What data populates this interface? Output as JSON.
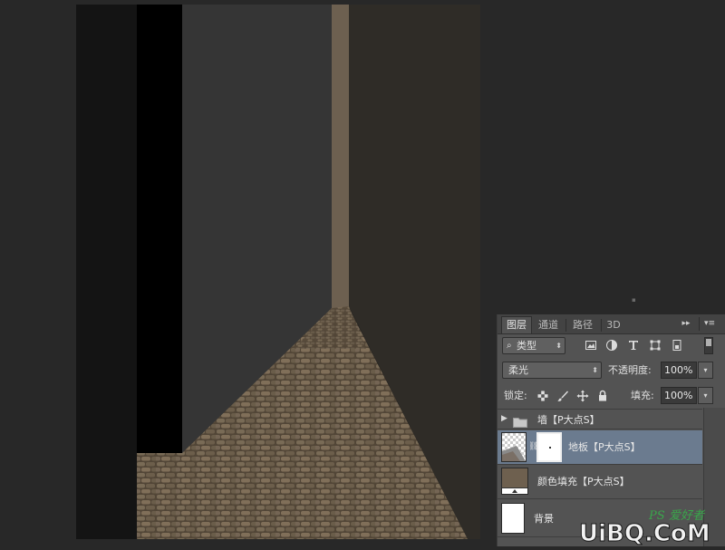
{
  "layers_panel": {
    "tabs": [
      {
        "label": "图层"
      },
      {
        "label": "通道"
      },
      {
        "label": "路径"
      },
      {
        "label": "3D"
      }
    ],
    "menu_expand_glyph": "▸▸",
    "menu_glyph": "▾≡",
    "filter": {
      "kind_label": "类型",
      "filter_icons": [
        "image-filter-icon",
        "adjustment-filter-icon",
        "type-filter-icon",
        "shape-filter-icon",
        "smart-object-filter-icon"
      ]
    },
    "blend_mode": "柔光",
    "opacity": {
      "label": "不透明度:",
      "value": "100%"
    },
    "lock": {
      "label": "锁定:",
      "icons": [
        "lock-transparent-pixels-icon",
        "lock-image-pixels-icon",
        "lock-position-icon",
        "lock-all-icon"
      ]
    },
    "fill": {
      "label": "填充:",
      "value": "100%"
    },
    "layers": [
      {
        "name": "墙【P大点S】",
        "type": "group",
        "expanded": false
      },
      {
        "name": "地板【P大点S】",
        "type": "pixel-with-mask",
        "selected": true
      },
      {
        "name": "颜色填充【P大点S】",
        "type": "fill",
        "color": "#6e604f"
      },
      {
        "name": "背景",
        "type": "background"
      }
    ]
  },
  "watermark": {
    "text": "UiBQ.CoM",
    "sub": "PS爱好者",
    "url": "www.psahz.com"
  },
  "colors": {
    "app_bg": "#282828",
    "panel_bg": "#535353",
    "selected_layer": "#6b7b8f",
    "floor_tone": "#7a6a55",
    "fill_color": "#6e604f"
  }
}
